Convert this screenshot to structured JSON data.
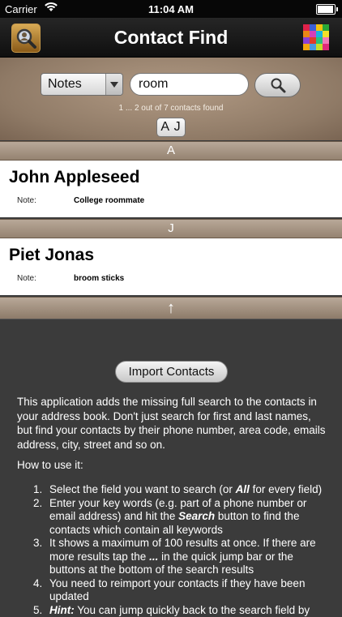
{
  "status": {
    "carrier": "Carrier",
    "time": "11:04 AM"
  },
  "nav": {
    "title": "Contact Find"
  },
  "search": {
    "field": "Notes",
    "query": "room",
    "found": "1 ... 2 out of 7 contacts found",
    "jump": "A J"
  },
  "sections": [
    {
      "letter": "A",
      "name": "John Appleseed",
      "note_label": "Note:",
      "note_value": "College roommate"
    },
    {
      "letter": "J",
      "name": "Piet Jonas",
      "note_label": "Note:",
      "note_value": "broom sticks"
    }
  ],
  "up_arrow": "↑",
  "info": {
    "import_label": "Import Contacts",
    "description": "This application adds the missing full search to the contacts in your address book. Don't just search for first and last names, but find your contacts by their phone number, area code, emails address, city, street and so on.",
    "howto": "How to use it:",
    "steps": [
      {
        "num": "1.",
        "pre": "Select the field you want to search (or ",
        "em": "All",
        "post": " for every field)"
      },
      {
        "num": "2.",
        "pre": "Enter your key words (e.g. part of a phone number or email address) and hit the ",
        "em": "Search",
        "post": " button to find the contacts which contain all keywords"
      },
      {
        "num": "3.",
        "pre": "It shows a maximum of 100 results at once. If there are more results tap the ",
        "em": "...",
        "post": " in the quick jump bar or the buttons at the bottom of the search results"
      },
      {
        "num": "4.",
        "pre": "You need to reimport your contacts if they have been updated",
        "em": "",
        "post": ""
      },
      {
        "num": "5.",
        "pre": "",
        "em": "Hint:",
        "post": " You can jump quickly back to the search field by"
      }
    ]
  },
  "colors": {
    "accent": "#8f7a66",
    "navbar": "#1a1a1a",
    "info_bg": "#3b3b3b"
  }
}
